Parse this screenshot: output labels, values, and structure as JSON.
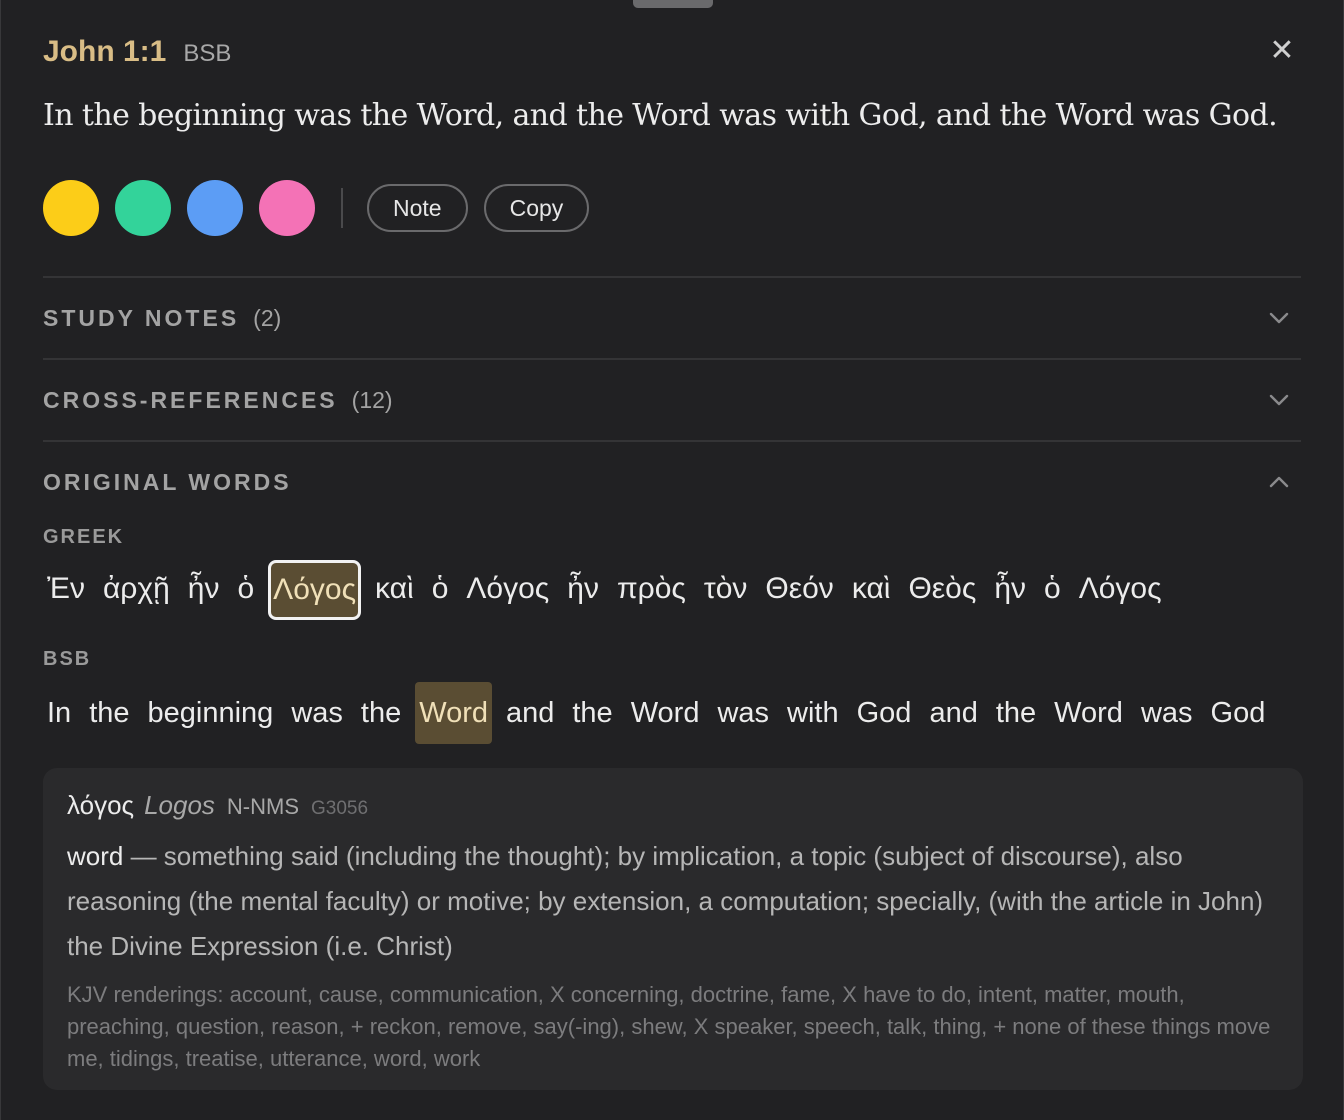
{
  "header": {
    "reference": "John 1:1",
    "version": "BSB",
    "close_label": "✕"
  },
  "verse": {
    "text": "In the beginning was the Word, and the Word was with God, and the Word was God."
  },
  "highlight_colors": [
    {
      "name": "yellow",
      "hex": "#fccd18"
    },
    {
      "name": "green",
      "hex": "#33d39a"
    },
    {
      "name": "blue",
      "hex": "#5c9df5"
    },
    {
      "name": "pink",
      "hex": "#f472b6"
    }
  ],
  "actions": {
    "note_label": "Note",
    "copy_label": "Copy"
  },
  "sections": {
    "study_notes": {
      "title": "STUDY NOTES",
      "count": "(2)",
      "expanded": false
    },
    "cross_references": {
      "title": "CROSS-REFERENCES",
      "count": "(12)",
      "expanded": false
    },
    "original_words": {
      "title": "ORIGINAL WORDS",
      "expanded": true
    }
  },
  "original": {
    "greek_label": "GREEK",
    "greek_words": [
      "Ἐν",
      "ἀρχῇ",
      "ἦν",
      "ὁ",
      "Λόγος",
      "καὶ",
      "ὁ",
      "Λόγος",
      "ἦν",
      "πρὸς",
      "τὸν",
      "Θεόν",
      "καὶ",
      "Θεὸς",
      "ἦν",
      "ὁ",
      "Λόγος"
    ],
    "greek_selected_index": 4,
    "english_label": "BSB",
    "english_words": [
      "In",
      "the",
      "beginning",
      "was",
      "the",
      "Word",
      "and",
      "the",
      "Word",
      "was",
      "with",
      "God",
      "and",
      "the",
      "Word",
      "was",
      "God"
    ],
    "english_selected_index": 5
  },
  "lexicon": {
    "lemma": "λόγος",
    "transliteration": "Logos",
    "parsing": "N-NMS",
    "strongs": "G3056",
    "gloss": "word",
    "definition": " — something said (including the thought); by implication, a topic (subject of discourse), also reasoning (the mental faculty) or motive; by extension, a computation; specially, (with the article in John) the Divine Expression (i.e. Christ)",
    "kjv": "KJV renderings: account, cause, communication, X concerning, doctrine, fame, X have to do, intent, matter, mouth, preaching, question, reason, + reckon, remove, say(-ing), shew, X speaker, speech, talk, thing, + none of these things move me, tidings, treatise, utterance, word, work"
  }
}
